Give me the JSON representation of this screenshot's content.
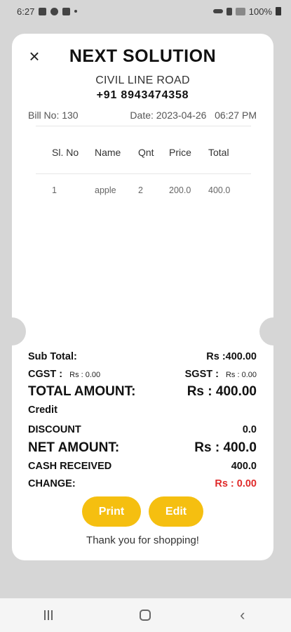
{
  "status_bar": {
    "time": "6:27",
    "battery": "100%"
  },
  "receipt": {
    "shop_name": "NEXT SOLUTION",
    "address": "CIVIL LINE ROAD",
    "phone": "+91 8943474358",
    "bill_no": "Bill No: 130",
    "date": "Date: 2023-04-26",
    "time": "06:27 PM",
    "columns": [
      "Sl. No",
      "Name",
      "Qnt",
      "Price",
      "Total"
    ],
    "items": [
      {
        "sl": "1",
        "name": "apple",
        "qnt": "2",
        "price": "200.0",
        "total": "400.0"
      }
    ],
    "sub_total_label": "Sub Total:",
    "sub_total_value": "Rs :400.00",
    "cgst_label": "CGST :",
    "cgst_value": "Rs : 0.00",
    "sgst_label": "SGST :",
    "sgst_value": "Rs : 0.00",
    "total_label": "TOTAL AMOUNT:",
    "total_value": "Rs : 400.00",
    "payment_mode": "Credit",
    "discount_label": "DISCOUNT",
    "discount_value": "0.0",
    "net_label": "NET AMOUNT:",
    "net_value": "Rs : 400.0",
    "cash_label": "CASH RECEIVED",
    "cash_value": "400.0",
    "change_label": "CHANGE:",
    "change_value": "Rs : 0.00",
    "print_label": "Print",
    "edit_label": "Edit",
    "thanks": "Thank you for shopping!"
  },
  "colors": {
    "accent": "#f5bf10",
    "change": "#e02a2a",
    "background": "#d6d6d6"
  }
}
